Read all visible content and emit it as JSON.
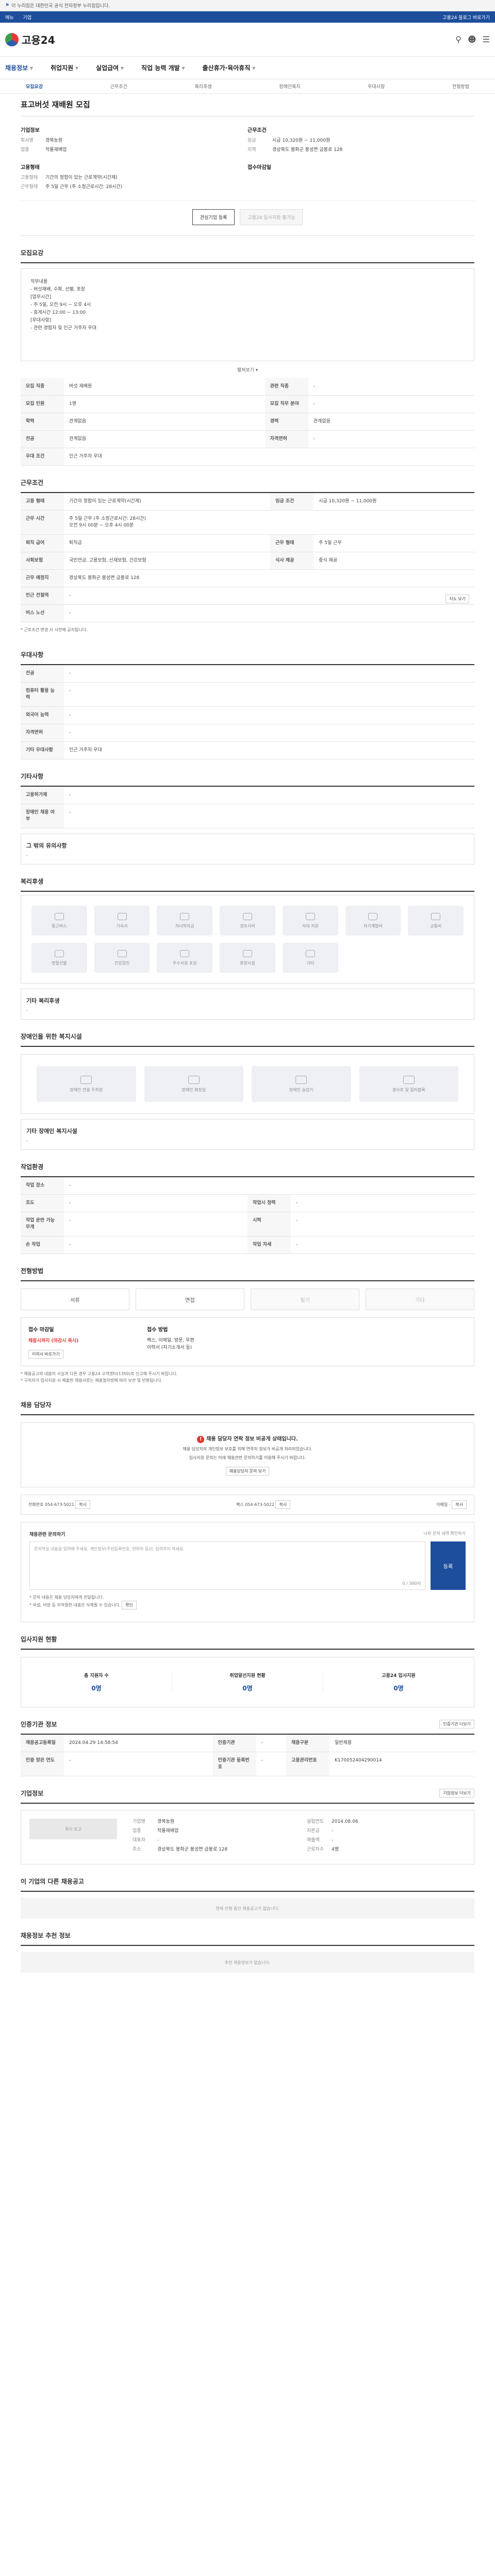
{
  "gov_bar": {
    "text": "이 누리집은 대한민국 공식 전자정부 누리집입니다."
  },
  "sub_bar": {
    "items": [
      "메뉴",
      "기업"
    ],
    "right": "고용24 블로그 바로가기"
  },
  "header": {
    "logo": "고용24"
  },
  "gnb": {
    "menus": [
      "채용정보",
      "취업지원",
      "실업급여",
      "직업 능력 개발",
      "출산휴가·육아휴직"
    ]
  },
  "sub_tabs": [
    "모집요강",
    "근무조건",
    "복리후생",
    "장애인복지",
    "우대사항",
    "전형방법"
  ],
  "job": {
    "title": "표고버섯 재배원 모집",
    "company_label": "기업정보",
    "company_rows": [
      {
        "k": "회사명",
        "v": "경북농원"
      },
      {
        "k": "업종",
        "v": "작물재배업"
      }
    ],
    "cond_label": "근무조건",
    "cond_rows": [
      {
        "k": "임금",
        "v": "시급 10,320원 ~ 11,000원"
      },
      {
        "k": "지역",
        "v": "경상북도 봉화군 봉성면 금봉로 128"
      }
    ],
    "type_label": "고용형태",
    "type_rows": [
      {
        "k": "고용형태",
        "v": "기간의 정함이 있는 근로계약(시간제)"
      },
      {
        "k": "근무형태",
        "v": "주 5일 근무 (주 소정근로시간: 28시간)"
      }
    ],
    "deadline_label": "접수마감일",
    "btn_interest": "관심기업 등록",
    "btn_apply": "고용24 입사지원 불가능"
  },
  "recruit": {
    "head": "모집요강",
    "desc_lines": [
      "직무내용",
      "- 버섯재배, 수확, 선별, 포장",
      "",
      "[업무시간]",
      "- 주 5일, 오전 9시 ~ 오후 4시",
      "- 휴게시간 12:00 ~ 13:00",
      "",
      "[우대사항]",
      "- 관련 경험자 및 인근 거주자 우대"
    ],
    "fold": "펼쳐보기",
    "rows": [
      [
        "모집 직종",
        "버섯 재배원",
        "관련 직종",
        "-"
      ],
      [
        "모집 인원",
        "1명",
        "모집 직무 분야",
        "-"
      ],
      [
        "학력",
        "관계없음",
        "경력",
        "관계없음"
      ],
      [
        "전공",
        "관계없음",
        "자격면허",
        "-"
      ],
      [
        "우대 조건",
        "인근 거주자 우대",
        "",
        ""
      ]
    ]
  },
  "work": {
    "head": "근무조건",
    "rows": [
      [
        "고용 형태",
        "기간의 정함이 있는 근로계약(시간제)",
        "임금 조건",
        "시급 10,320원 ~ 11,000원"
      ],
      [
        "근무 시간",
        "주 5일 근무 (주 소정근로시간: 28시간)\n오전 9시 00분 ~ 오후 4시 00분",
        "",
        ""
      ],
      [
        "퇴직 급여",
        "퇴직금",
        "근무 형태",
        "주 5일 근무"
      ],
      [
        "사회보험",
        "국민연금, 고용보험, 산재보험, 건강보험",
        "식사 제공",
        "중식 제공"
      ],
      [
        "근무 예정지",
        "경상북도 봉화군 봉성면 금봉로 128",
        "",
        ""
      ],
      [
        "인근 전철역",
        "-",
        "",
        ""
      ],
      [
        "버스 노선",
        "-",
        "",
        ""
      ]
    ],
    "map_btn": "지도 보기",
    "note": "* 근로조건 변경 시 사전에 공지됩니다."
  },
  "pref": {
    "head": "우대사항",
    "rows": [
      [
        "전공",
        "-"
      ],
      [
        "컴퓨터 활용 능력",
        "-"
      ],
      [
        "외국어 능력",
        "-"
      ],
      [
        "자격면허",
        "-"
      ],
      [
        "기타 우대사항",
        "인근 거주자 우대"
      ]
    ]
  },
  "etc": {
    "head": "기타사항",
    "rows": [
      [
        "고용허가제",
        "-"
      ],
      [
        "장애인 채용 여부",
        "-"
      ]
    ],
    "sub": "그 밖의 유의사항",
    "sub_text": "-"
  },
  "welfare": {
    "head": "복리후생",
    "items": [
      "통근버스",
      "기숙사",
      "자녀학자금",
      "경조사비",
      "식대 지원",
      "자기계발비",
      "교통비",
      "명절선물",
      "건강검진",
      "우수사원 포상",
      "휴양시설",
      "기타"
    ],
    "sub": "기타 복리후생",
    "sub_text": "-"
  },
  "disabled": {
    "head": "장애인을 위한 복지시설",
    "items": [
      "장애인 전용 주차장",
      "장애인 화장실",
      "장애인 승강기",
      "경사로 및 점자블록"
    ],
    "sub": "기타 장애인 복지시설",
    "sub_text": "-"
  },
  "env": {
    "head": "작업환경",
    "rows": [
      [
        "작업 장소",
        "-",
        "",
        ""
      ],
      [
        "조도",
        "-",
        "작업시 청력",
        "-"
      ],
      [
        "작업 운반 가능 무게",
        "-",
        "시력",
        "-"
      ],
      [
        "손 작업",
        "-",
        "작업 자세",
        "-"
      ]
    ]
  },
  "method": {
    "head": "전형방법",
    "buttons": [
      "서류",
      "면접",
      "필기",
      "기타"
    ],
    "doc_label": "접수 마감일",
    "doc_value": "채용시까지 (마감시 즉시)",
    "doc_btn": "이력서 바로가기",
    "submit_label": "접수 방법",
    "submit_lines": [
      "팩스, 이메일, 방문, 우편",
      "이력서 (자기소개서 등)"
    ],
    "disc": [
      "* 채용공고의 내용이 사실과 다른 경우 고용24 고객센터(1350)로 신고해 주시기 바랍니다.",
      "* 구직자가 입사지원 시 제출한 채용서류는 채용절차법에 따라 보관 및 반환됩니다."
    ]
  },
  "manager": {
    "head": "채용 담당자",
    "warn": "채용 담당자 연락 정보 비공개 상태입니다.",
    "lines": [
      "채용 담당자의 개인정보 보호를 위해 연락처 정보가 비공개 처리되었습니다.",
      "입사지원 문의는 아래 채용관련 문의하기를 이용해 주시기 바랍니다."
    ],
    "btn": "채용담당자 문의 보기",
    "contact_label": "전화번호",
    "contact": "054-673-5021",
    "fax_label": "팩스",
    "fax": "054-673-5022",
    "email_label": "이메일",
    "email": "-",
    "btn_copy": "복사"
  },
  "ask": {
    "head": "채용관련 문의하기",
    "right": "나의 문의 내역 확인하기",
    "placeholder": "문의하실 내용을 입력해 주세요. 개인정보(주민등록번호, 연락처 등)는 입력하지 마세요.",
    "count": "0 / 300자",
    "btn": "등록",
    "notes": [
      "* 문의 내용은 채용 담당자에게 전달됩니다.",
      "* 욕설, 비방 등 부적절한 내용은 삭제될 수 있습니다."
    ],
    "notes_btn": "확인"
  },
  "stats": {
    "head": "입사지원 현황",
    "items": [
      {
        "n": "총 지원자 수",
        "v": "0명"
      },
      {
        "n": "취업알선지원 현황",
        "v": "0명"
      },
      {
        "n": "고용24 입사지원",
        "v": "0명"
      }
    ]
  },
  "info": {
    "head": "인증기관 정보",
    "rows": [
      [
        "채용공고등록일",
        "2024.04.29 14:58:54",
        "인증기관",
        "-",
        "채용구분",
        "일반채용"
      ],
      [
        "인증 받은 연도",
        "-",
        "인증기관 등록번호",
        "-",
        "고용관리번호",
        "K170052404290014"
      ]
    ],
    "btn": "인증기관 더보기"
  },
  "company": {
    "head": "기업정보",
    "logo": "회사 로고",
    "rows": [
      [
        "기업명",
        "경북농원"
      ],
      [
        "업종",
        "작물재배업"
      ],
      [
        "대표자",
        "-"
      ],
      [
        "주소",
        "경상북도 봉화군 봉성면 금봉로 128"
      ]
    ],
    "rows2": [
      [
        "설립연도",
        "2014.08.06"
      ],
      [
        "자본금",
        "-"
      ],
      [
        "매출액",
        "-"
      ],
      [
        "근로자수",
        "4명"
      ]
    ],
    "btn": "기업정보 더보기"
  },
  "other_jobs": {
    "head": "이 기업의 다른 채용공고",
    "text": "현재 진행 중인 채용공고가 없습니다."
  },
  "recommend": {
    "head": "채용정보 추천 정보",
    "text": "추천 채용정보가 없습니다."
  }
}
